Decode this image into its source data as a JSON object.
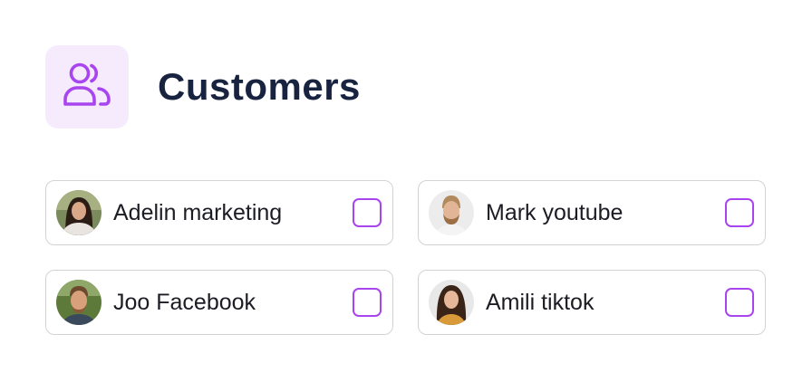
{
  "header": {
    "title": "Customers",
    "icon": "users-icon",
    "icon_color": "#a945ee",
    "icon_tile_bg": "#f5ebfd"
  },
  "customers": [
    {
      "name": "Adelin marketing",
      "avatar": "avatar-woman-dark-hair",
      "checked": false
    },
    {
      "name": "Mark youtube",
      "avatar": "avatar-man-beard",
      "checked": false
    },
    {
      "name": "Joo Facebook",
      "avatar": "avatar-man-outdoor",
      "checked": false
    },
    {
      "name": "Amili tiktok",
      "avatar": "avatar-woman-long-hair",
      "checked": false
    }
  ],
  "colors": {
    "title": "#17233f",
    "checkbox_border": "#a945ee",
    "card_border": "#d3d3d6"
  }
}
